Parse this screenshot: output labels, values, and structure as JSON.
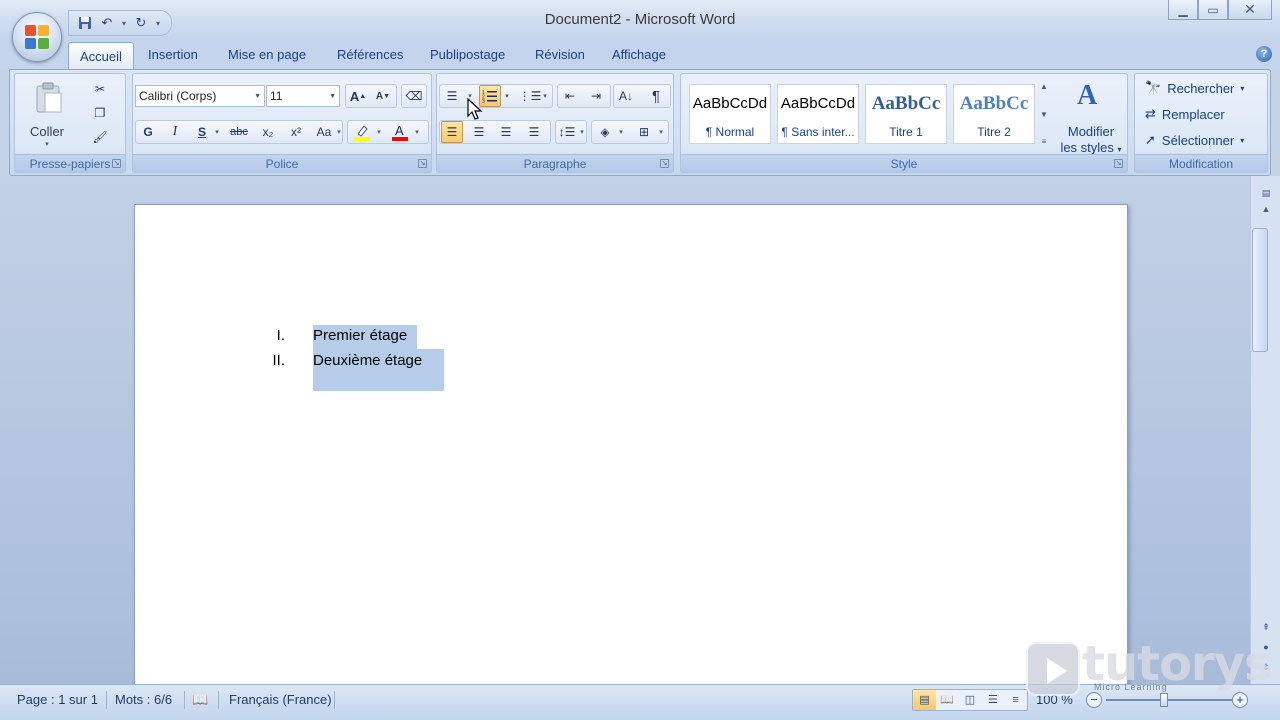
{
  "window": {
    "title": "Document2 - Microsoft Word"
  },
  "qat": {
    "icons": [
      "save-icon",
      "undo-icon",
      "redo-icon",
      "customize-icon"
    ]
  },
  "tabs": [
    {
      "label": "Accueil",
      "active": true
    },
    {
      "label": "Insertion"
    },
    {
      "label": "Mise en page"
    },
    {
      "label": "Références"
    },
    {
      "label": "Publipostage"
    },
    {
      "label": "Révision"
    },
    {
      "label": "Affichage"
    }
  ],
  "clipboard": {
    "label": "Presse-papiers",
    "paste": "Coller"
  },
  "font": {
    "label": "Police",
    "name": "Calibri (Corps)",
    "size": "11",
    "bold": "G",
    "italic": "I",
    "underline": "S",
    "strike": "abc",
    "subscript": "x₂",
    "superscript": "x²",
    "case": "Aa",
    "grow": "A",
    "shrink": "A",
    "color_letter": "A"
  },
  "paragraph": {
    "label": "Paragraphe",
    "show_marks": "¶"
  },
  "styles": {
    "label": "Style",
    "items": [
      {
        "preview": "AaBbCcDd",
        "name": "¶ Normal"
      },
      {
        "preview": "AaBbCcDd",
        "name": "¶ Sans inter..."
      },
      {
        "preview": "AaBbCc",
        "name": "Titre 1"
      },
      {
        "preview": "AaBbCc",
        "name": "Titre 2"
      }
    ],
    "modify_line1": "Modifier",
    "modify_line2": "les styles"
  },
  "editing": {
    "label": "Modification",
    "find": "Rechercher",
    "replace": "Remplacer",
    "select": "Sélectionner"
  },
  "document": {
    "list": [
      {
        "number": "I.",
        "text": "Premier étage"
      },
      {
        "number": "II.",
        "text": "Deuxième étage"
      }
    ]
  },
  "status": {
    "page": "Page : 1 sur 1",
    "words": "Mots : 6/6",
    "language": "Français (France)",
    "zoom": "100 %"
  },
  "watermark": {
    "text": "tutorys",
    "sub": "Micro Learning"
  },
  "colors": {
    "highlight": "#ffff00",
    "font_color": "#ff0000",
    "selection": "#b6cde9"
  }
}
